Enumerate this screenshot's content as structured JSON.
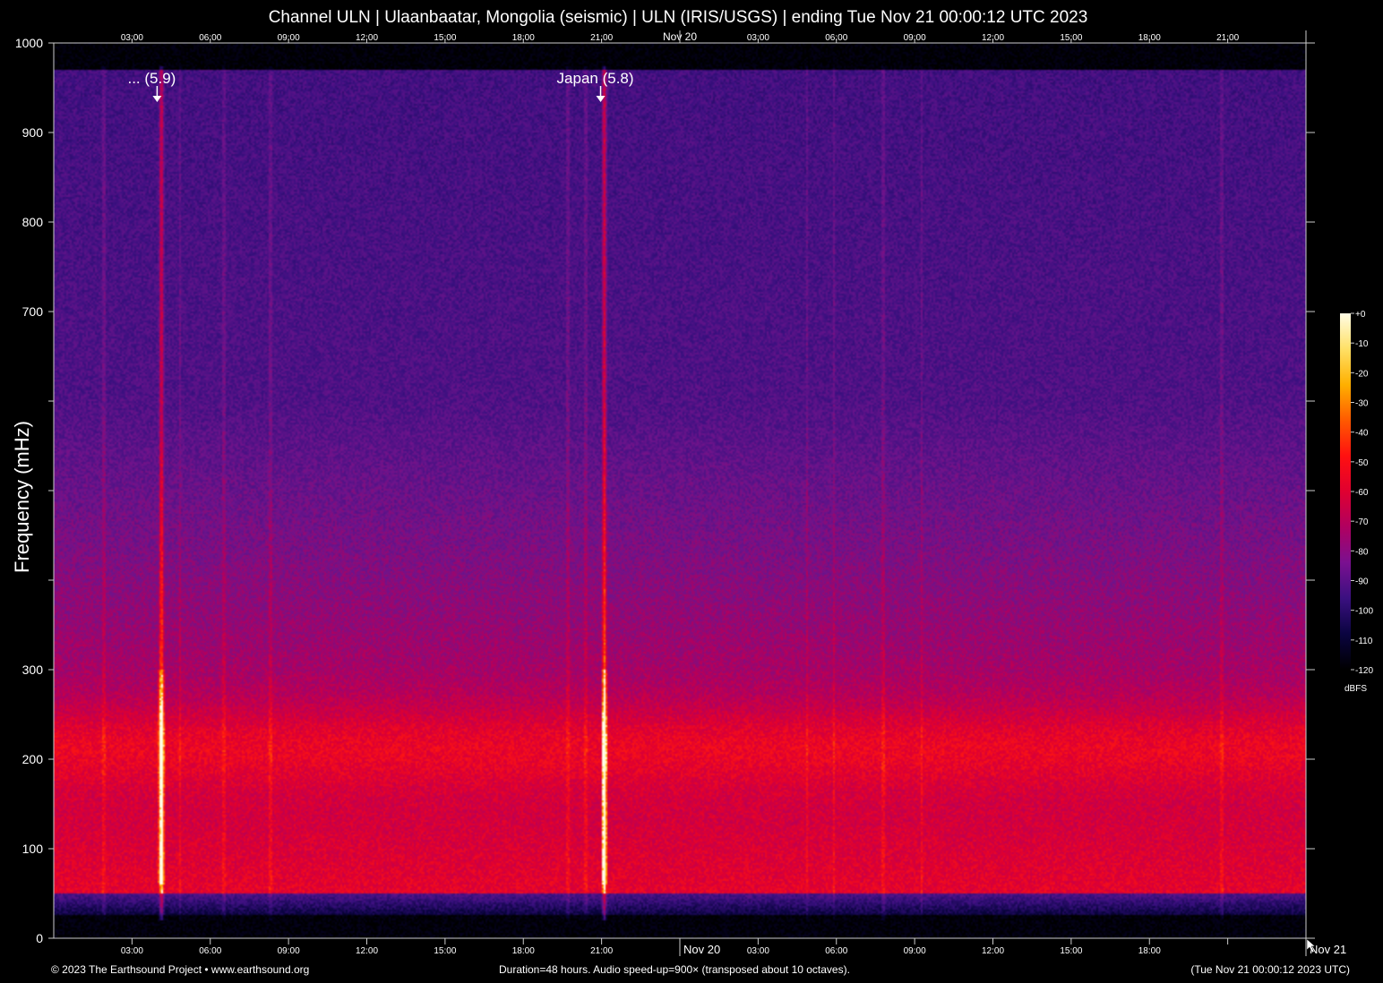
{
  "title": "Channel ULN | Ulaanbaatar, Mongolia (seismic) | ULN (IRIS/USGS) | ending Tue Nov 21 00:00:12 UTC 2023",
  "footer": {
    "left": "© 2023 The Earthsound Project • www.earthsound.org",
    "center": "Duration=48 hours. Audio speed-up=900× (transposed about 10 octaves).",
    "right": "(Tue Nov 21 00:00:12 2023 UTC)"
  },
  "colorbar": {
    "ticks": [
      "+0",
      "-10",
      "-20",
      "-30",
      "-40",
      "-50",
      "-60",
      "-70",
      "-80",
      "-90",
      "-100",
      "-110",
      "-120"
    ],
    "label": "dBFS",
    "colors": [
      "#fffde6",
      "#ffe066",
      "#ffb000",
      "#ff5a00",
      "#ff1010",
      "#e00030",
      "#b00060",
      "#7a1090",
      "#3a1080",
      "#0a0440",
      "#000000"
    ]
  },
  "chart_data": {
    "type": "heatmap",
    "title": "Channel ULN | Ulaanbaatar, Mongolia (seismic) | ULN (IRIS/USGS) | ending Tue Nov 21 00:00:12 UTC 2023",
    "xlabel": "",
    "ylabel": "Frequency (mHz)",
    "xlim_hours": [
      0,
      48
    ],
    "ylim": [
      0,
      1000
    ],
    "x_tick_labels": [
      "03:00",
      "06:00",
      "09:00",
      "12:00",
      "15:00",
      "18:00",
      "21:00",
      "Nov 20",
      "03:00",
      "06:00",
      "09:00",
      "12:00",
      "15:00",
      "18:00",
      "21:00"
    ],
    "x_tick_hours": [
      3,
      6,
      9,
      12,
      15,
      18,
      21,
      24,
      27,
      30,
      33,
      36,
      39,
      42,
      45
    ],
    "bottom_x_tick_labels": [
      "03:00",
      "06:00",
      "09:00",
      "12:00",
      "15:00",
      "18:00",
      "21:00",
      "Nov 20",
      "03:00",
      "06:00",
      "09:00",
      "12:00",
      "15:00",
      "18:00",
      "",
      "Nov 21"
    ],
    "bottom_x_tick_hours": [
      3,
      6,
      9,
      12,
      15,
      18,
      21,
      24,
      27,
      30,
      33,
      36,
      39,
      42,
      45,
      48
    ],
    "y_ticks": [
      0,
      100,
      200,
      300,
      400,
      500,
      600,
      700,
      800,
      900,
      1000
    ],
    "y_tick_labels": [
      "0",
      "100",
      "200",
      "300",
      "",
      "",
      "",
      "700",
      "800",
      "900",
      "1000"
    ],
    "color_scale": "dBFS",
    "color_range": [
      -120,
      0
    ],
    "annotations": [
      {
        "label": "... (5.9)",
        "hour": 4.1
      },
      {
        "label": "Japan (5.8)",
        "hour": 21.1
      }
    ],
    "bright_band_mHz": [
      150,
      280
    ],
    "quiet_band_mHz": [
      0,
      50
    ],
    "event_lines_hours": [
      4.1,
      21.1
    ]
  }
}
